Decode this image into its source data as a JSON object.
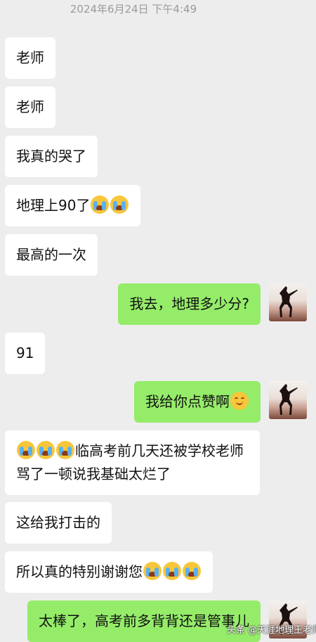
{
  "timestamp": "2024年6月24日 下午4:49",
  "messages": [
    {
      "side": "left",
      "text": "老师"
    },
    {
      "side": "left",
      "text": "老师"
    },
    {
      "side": "left",
      "text": "我真的哭了"
    },
    {
      "side": "left",
      "text": "地理上90了",
      "suffix_emojis": [
        "loudly-crying-face",
        "loudly-crying-face"
      ]
    },
    {
      "side": "left",
      "text": "最高的一次"
    },
    {
      "side": "right",
      "text": "我去，地理多少分?"
    },
    {
      "side": "left",
      "text": "91"
    },
    {
      "side": "right",
      "text": "我给你点赞啊",
      "suffix_emojis": [
        "smiling-face"
      ]
    },
    {
      "side": "left",
      "prefix_emojis": [
        "loudly-crying-face",
        "loudly-crying-face",
        "loudly-crying-face"
      ],
      "text": "临高考前几天还被学校老师骂了一顿说我基础太烂了"
    },
    {
      "side": "left",
      "text": "这给我打击的"
    },
    {
      "side": "left",
      "text": "所以真的特别谢谢您",
      "suffix_emojis": [
        "loudly-crying-face",
        "loudly-crying-face",
        "loudly-crying-face"
      ]
    },
    {
      "side": "right",
      "text": "太棒了，高考前多背背还是管事儿"
    }
  ],
  "watermark": "头条 @天涯地理王老师",
  "colors": {
    "background": "#ededed",
    "incoming": "#ffffff",
    "outgoing": "#95ec69"
  }
}
